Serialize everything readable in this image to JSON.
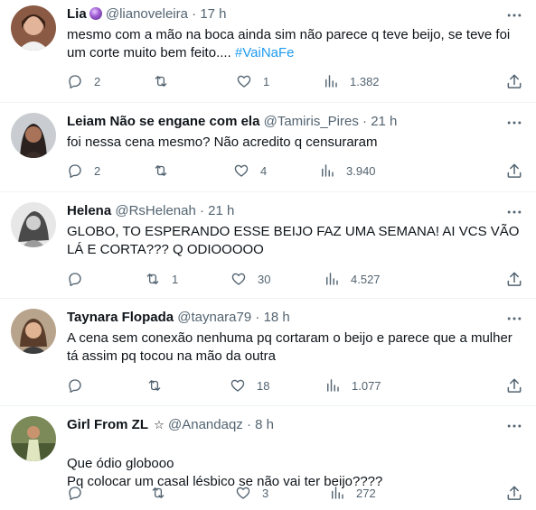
{
  "tweets": [
    {
      "name": "Lia",
      "handle": "@lianoveleira",
      "dot": "·",
      "time": "17 h",
      "text": "mesmo com a mão na boca ainda sim não parece q teve beijo, se teve foi um corte muito bem feito.... ",
      "hashtag": "#VaiNaFe",
      "replies": "2",
      "retweets": "",
      "likes": "1",
      "views": "1.382",
      "has_badge": true
    },
    {
      "name": "Leiam Não se engane com ela",
      "handle": "@Tamiris_Pires",
      "dot": "·",
      "time": "21 h",
      "text": "foi nessa cena mesmo? Não acredito q censuraram",
      "hashtag": "",
      "replies": "2",
      "retweets": "",
      "likes": "4",
      "views": "3.940"
    },
    {
      "name": "Helena",
      "handle": "@RsHelenah",
      "dot": "·",
      "time": "21 h",
      "text": "GLOBO, TO ESPERANDO ESSE BEIJO FAZ UMA SEMANA! AI VCS VÃO LÁ E CORTA??? Q ODIOOOOO",
      "hashtag": "",
      "replies": "",
      "retweets": "1",
      "likes": "30",
      "views": "4.527"
    },
    {
      "name": "Taynara Flopada",
      "handle": "@taynara79",
      "dot": "·",
      "time": "18 h",
      "text": "A cena sem conexão nenhuma pq cortaram o beijo e parece que a mulher tá assim pq tocou na mão da outra",
      "hashtag": "",
      "replies": "",
      "retweets": "",
      "likes": "18",
      "views": "1.077"
    },
    {
      "name": "Girl From ZL",
      "name_suffix": "☆",
      "handle": "@Anandaqz",
      "dot": "·",
      "time": "8 h",
      "text": "Que ódio globooo\nPq colocar um casal lésbico se não vai ter beijo????",
      "hashtag": "",
      "replies": "",
      "retweets": "",
      "likes": "3",
      "views": "272"
    }
  ],
  "icons": {
    "reply": "reply-icon",
    "retweet": "retweet-icon",
    "like": "heart-icon",
    "views": "views-icon",
    "share": "share-icon",
    "more": "more-icon",
    "badge": "verified-badge-icon"
  },
  "colors": {
    "text": "#0f1419",
    "secondary": "#536471",
    "link": "#1d9bf0",
    "divider": "#eff3f4"
  }
}
